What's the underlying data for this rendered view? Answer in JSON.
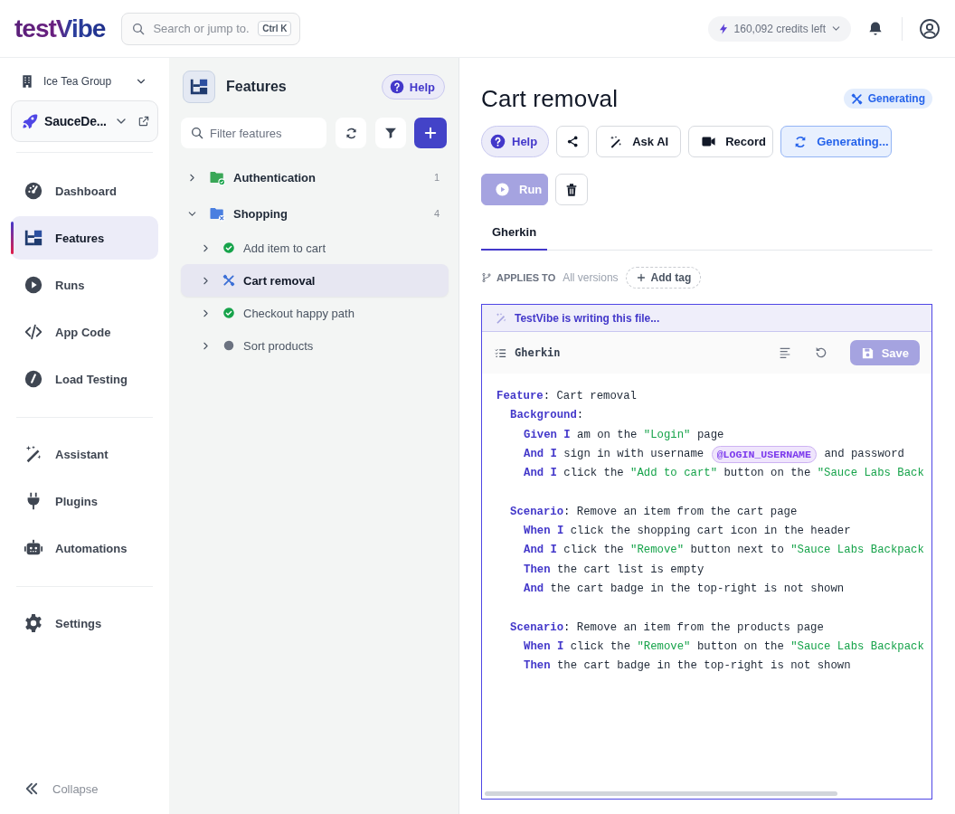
{
  "topbar": {
    "logo": "testVibe",
    "search": {
      "placeholder": "Search or jump to.",
      "shortcut": "Ctrl K"
    },
    "credits": "160,092 credits left"
  },
  "sidebar": {
    "organization": "Ice Tea Group",
    "project": "SauceDe...",
    "nav_groups": [
      [
        {
          "label": "Dashboard",
          "selected": false
        },
        {
          "label": "Features",
          "selected": true
        },
        {
          "label": "Runs",
          "selected": false
        },
        {
          "label": "App Code",
          "selected": false
        },
        {
          "label": "Load Testing",
          "selected": false
        }
      ],
      [
        {
          "label": "Assistant",
          "selected": false
        },
        {
          "label": "Plugins",
          "selected": false
        },
        {
          "label": "Automations",
          "selected": false
        }
      ],
      [
        {
          "label": "Settings",
          "selected": false
        }
      ]
    ],
    "collapse": "Collapse"
  },
  "features_panel": {
    "title": "Features",
    "help": "Help",
    "filter": {
      "placeholder": "Filter features"
    },
    "tree": [
      {
        "name": "Authentication",
        "count": "1",
        "kind": "passed",
        "expanded": false,
        "selected": false
      },
      {
        "name": "Shopping",
        "count": "4",
        "kind": "generating",
        "expanded": true,
        "selected": false,
        "children": [
          {
            "name": "Add item to cart",
            "kind": "passed",
            "expanded": false,
            "selected": false
          },
          {
            "name": "Cart removal",
            "kind": "generating",
            "expanded": false,
            "selected": true
          },
          {
            "name": "Checkout happy path",
            "kind": "passed",
            "expanded": false,
            "selected": false
          },
          {
            "name": "Sort products",
            "kind": "none",
            "expanded": false,
            "selected": false
          }
        ]
      }
    ]
  },
  "detail": {
    "title": "Cart removal",
    "status": "Generating",
    "actions": [
      {
        "kind": "help",
        "label": "Help",
        "disabled": false
      },
      {
        "kind": "share",
        "disabled": false
      },
      {
        "kind": "ask",
        "label": "Ask AI",
        "disabled": false
      },
      {
        "kind": "record",
        "label": "Record",
        "disabled": false
      },
      {
        "kind": "generating",
        "label": "Generating...",
        "disabled": false
      },
      {
        "kind": "run",
        "label": "Run",
        "disabled": true
      },
      {
        "kind": "delete",
        "disabled": false
      }
    ],
    "tabs": [
      {
        "label": "Gherkin",
        "selected": true
      }
    ],
    "applies_to": {
      "label": "APPLIES TO",
      "value": "All versions",
      "add_tag": "Add tag"
    },
    "editor": {
      "banner": "TestVibe is writing this file...",
      "file": "Gherkin",
      "save": {
        "label": "Save",
        "disabled": true
      },
      "code": [
        {
          "tokens": [
            {
              "kind": "keyword",
              "text": "Feature"
            },
            {
              "kind": "text",
              "text": ": Cart removal"
            }
          ],
          "children": [
            {
              "tokens": [
                {
                  "kind": "keyword",
                  "text": "Background"
                },
                {
                  "kind": "text",
                  "text": ":"
                }
              ],
              "children": [
                {
                  "tokens": [
                    {
                      "kind": "keyword",
                      "text": "Given I"
                    },
                    {
                      "kind": "text",
                      "text": " am on the "
                    },
                    {
                      "kind": "string",
                      "text": "\"Login\""
                    },
                    {
                      "kind": "text",
                      "text": " page"
                    }
                  ]
                },
                {
                  "tokens": [
                    {
                      "kind": "keyword",
                      "text": "And I"
                    },
                    {
                      "kind": "text",
                      "text": " sign in with username "
                    },
                    {
                      "kind": "variable",
                      "text": "@LOGIN_USERNAME"
                    },
                    {
                      "kind": "text",
                      "text": " and password"
                    }
                  ]
                },
                {
                  "tokens": [
                    {
                      "kind": "keyword",
                      "text": "And I"
                    },
                    {
                      "kind": "text",
                      "text": " click the "
                    },
                    {
                      "kind": "string",
                      "text": "\"Add to cart\""
                    },
                    {
                      "kind": "text",
                      "text": " button on the "
                    },
                    {
                      "kind": "string",
                      "text": "\"Sauce Labs Back"
                    }
                  ]
                }
              ]
            },
            {
              "tokens": [
                {
                  "kind": "keyword",
                  "text": "Scenario"
                },
                {
                  "kind": "text",
                  "text": ": Remove an item from the cart page"
                }
              ],
              "children": [
                {
                  "tokens": [
                    {
                      "kind": "keyword",
                      "text": "When I"
                    },
                    {
                      "kind": "text",
                      "text": " click the shopping cart icon in the header"
                    }
                  ]
                },
                {
                  "tokens": [
                    {
                      "kind": "keyword",
                      "text": "And I"
                    },
                    {
                      "kind": "text",
                      "text": " click the "
                    },
                    {
                      "kind": "string",
                      "text": "\"Remove\""
                    },
                    {
                      "kind": "text",
                      "text": " button next to "
                    },
                    {
                      "kind": "string",
                      "text": "\"Sauce Labs Backpack"
                    }
                  ]
                },
                {
                  "tokens": [
                    {
                      "kind": "keyword",
                      "text": "Then"
                    },
                    {
                      "kind": "text",
                      "text": " the cart list is empty"
                    }
                  ]
                },
                {
                  "tokens": [
                    {
                      "kind": "keyword",
                      "text": "And"
                    },
                    {
                      "kind": "text",
                      "text": " the cart badge in the top-right is not shown"
                    }
                  ]
                }
              ]
            },
            {
              "tokens": [
                {
                  "kind": "keyword",
                  "text": "Scenario"
                },
                {
                  "kind": "text",
                  "text": ": Remove an item from the products page"
                }
              ],
              "children": [
                {
                  "tokens": [
                    {
                      "kind": "keyword",
                      "text": "When I"
                    },
                    {
                      "kind": "text",
                      "text": " click the "
                    },
                    {
                      "kind": "string",
                      "text": "\"Remove\""
                    },
                    {
                      "kind": "text",
                      "text": " button on the "
                    },
                    {
                      "kind": "string",
                      "text": "\"Sauce Labs Backpack"
                    }
                  ]
                },
                {
                  "tokens": [
                    {
                      "kind": "keyword",
                      "text": "Then"
                    },
                    {
                      "kind": "text",
                      "text": " the cart badge in the top-right is not shown"
                    }
                  ]
                }
              ]
            }
          ]
        }
      ]
    }
  }
}
